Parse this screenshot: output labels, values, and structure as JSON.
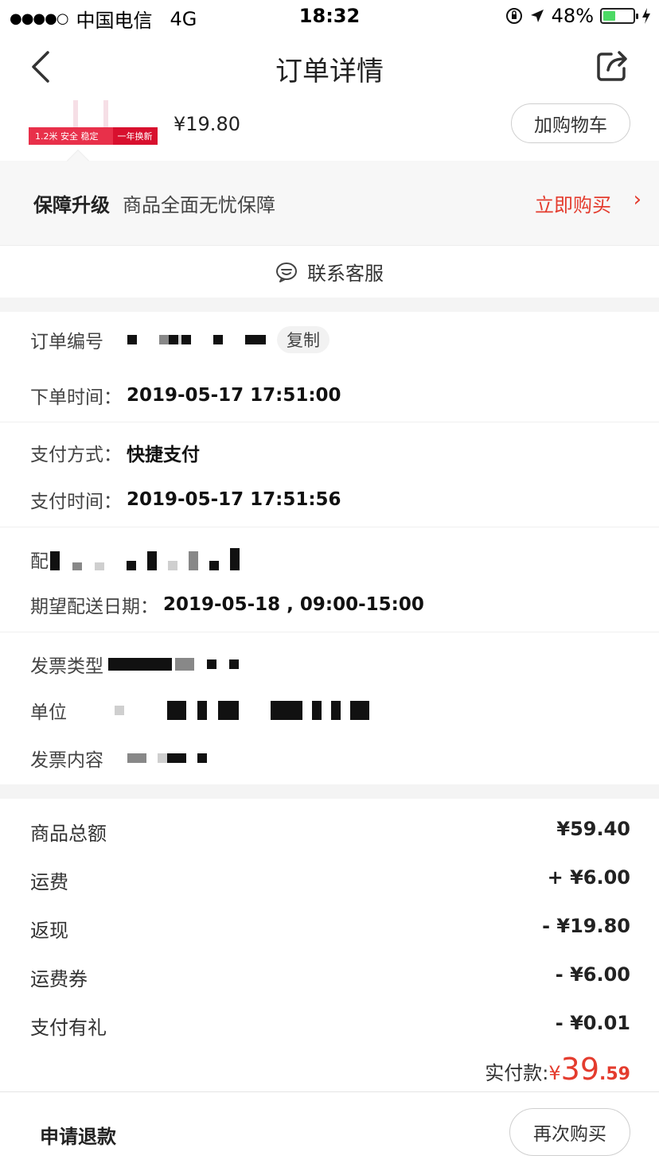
{
  "status_bar": {
    "signal": "●●●●○",
    "carrier": "中国电信",
    "network": "4G",
    "time": "18:32",
    "battery_percent": "48%",
    "battery_level": 0.48,
    "battery_color": "#4cd964"
  },
  "nav": {
    "title": "订单详情"
  },
  "product": {
    "image_tag_left": "1.2米 安全 稳定",
    "image_tag_right": "一年换新",
    "price": "¥19.80",
    "add_cart_label": "加购物车"
  },
  "guarantee": {
    "title": "保障升级",
    "description": "商品全面无忧保障",
    "buy_label": "立即购买",
    "arrow": "›"
  },
  "contact": {
    "label": "联系客服"
  },
  "order_info": {
    "order_no_label": "订单编号",
    "copy_label": "复制",
    "order_time_label": "下单时间：",
    "order_time": "2019-05-17 17:51:00",
    "pay_method_label": "支付方式：",
    "pay_method": "快捷支付",
    "pay_time_label": "支付时间：",
    "pay_time": "2019-05-17 17:51:56",
    "delivery_label": "配",
    "expected_date_label": "期望配送日期：",
    "expected_date": "2019-05-18 , 09:00-15:00",
    "invoice_type_label": "发票类型",
    "company_label": "单位",
    "invoice_content_label": "发票内容"
  },
  "amounts": {
    "items": [
      {
        "label": "商品总额",
        "value": "¥59.40"
      },
      {
        "label": "运费",
        "value": "+ ¥6.00"
      },
      {
        "label": "返现",
        "value": "- ¥19.80"
      },
      {
        "label": "运费券",
        "value": "- ¥6.00"
      },
      {
        "label": "支付有礼",
        "value": "- ¥0.01"
      }
    ],
    "total_label": "实付款:",
    "total_currency": "¥",
    "total_integer": "39",
    "total_decimal": ".59",
    "accent_color": "#e43c2e"
  },
  "bottom": {
    "refund_label": "申请退款",
    "rebuy_label": "再次购买"
  }
}
